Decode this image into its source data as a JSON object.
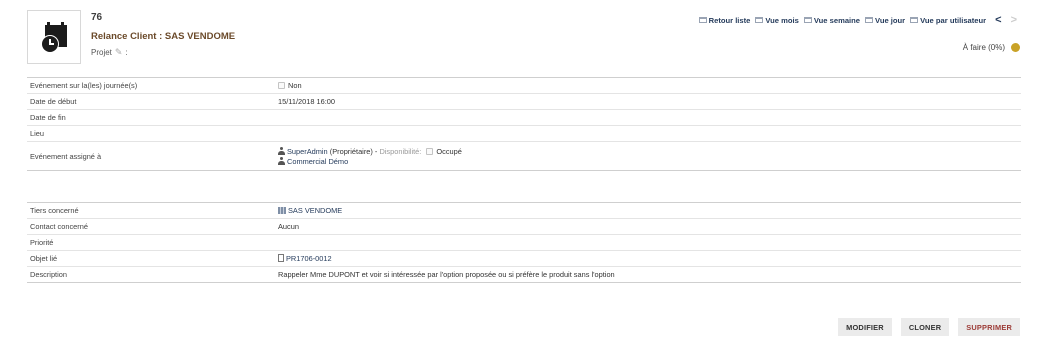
{
  "header": {
    "ref": "76",
    "title": "Relance Client : SAS VENDOME",
    "projet_label": "Projet",
    "projet_sep": ":"
  },
  "nav": {
    "items": [
      {
        "label": "Retour liste",
        "icon": "list-icon"
      },
      {
        "label": "Vue mois",
        "icon": "calendar-month-icon"
      },
      {
        "label": "Vue semaine",
        "icon": "calendar-week-icon"
      },
      {
        "label": "Vue jour",
        "icon": "calendar-day-icon"
      },
      {
        "label": "Vue par utilisateur",
        "icon": "calendar-user-icon"
      }
    ],
    "prev": "<",
    "next": ">"
  },
  "status": {
    "label": "À faire (0%)",
    "color": "#c9a227"
  },
  "fields": {
    "journee": {
      "label": "Evénement sur la(les) journée(s)",
      "value": "Non"
    },
    "date_debut": {
      "label": "Date de début",
      "value": "15/11/2018 16:00"
    },
    "date_fin": {
      "label": "Date de fin",
      "value": ""
    },
    "lieu": {
      "label": "Lieu",
      "value": ""
    },
    "assigne": {
      "label": "Evénement assigné à",
      "owner_name": "SuperAdmin",
      "owner_role": "(Propriétaire) -",
      "dispo_label": "Disponibilité:",
      "dispo_value": "Occupé",
      "second_user": "Commercial Démo"
    },
    "tiers": {
      "label": "Tiers concerné",
      "value": "SAS VENDOME"
    },
    "contact": {
      "label": "Contact concerné",
      "value": "Aucun"
    },
    "priorite": {
      "label": "Priorité",
      "value": ""
    },
    "objet": {
      "label": "Objet lié",
      "value": "PR1706-0012"
    },
    "description": {
      "label": "Description",
      "value": "Rappeler Mme DUPONT et voir si intéressée par l'option proposée ou si préfère le produit sans l'option"
    }
  },
  "actions": {
    "modify": "MODIFIER",
    "clone": "CLONER",
    "delete": "SUPPRIMER"
  }
}
